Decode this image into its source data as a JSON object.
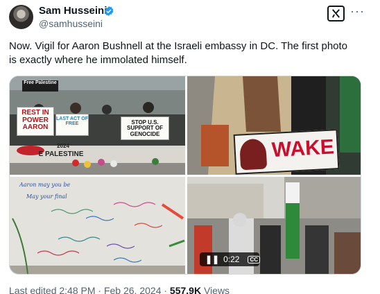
{
  "author": {
    "name": "Sam Husseini",
    "handle": "@samhusseini",
    "verified_color": "#1d9bf0"
  },
  "actions": {
    "grok_icon": "grok-icon",
    "more": "···"
  },
  "tweet": {
    "text": "Now. Vigil for Aaron Bushnell at the Israeli embassy in DC. The first photo is exactly where he immolated himself."
  },
  "media": {
    "photo1": {
      "signs": [
        "Free Palestine",
        "REST IN POWER AARON",
        "LAST ACT OF FREE",
        "STOP U.S. SUPPORT OF GENOCIDE",
        "2024",
        "E PALESTINE"
      ]
    },
    "photo2": {
      "sign": "WAKE"
    },
    "photo3": {
      "handwriting": [
        "Aaron may you be",
        "May your final"
      ]
    },
    "video": {
      "duration": "0:22",
      "play_icon": "pause-icon",
      "captions_label": "CC"
    }
  },
  "footer": {
    "edited": "Last edited 2:48 PM · Feb 26, 2024 ·",
    "views_count": "557.9K",
    "views_label": "Views"
  },
  "colors": {
    "text_primary": "#0f1419",
    "text_secondary": "#536471",
    "accent": "#1d9bf0"
  }
}
